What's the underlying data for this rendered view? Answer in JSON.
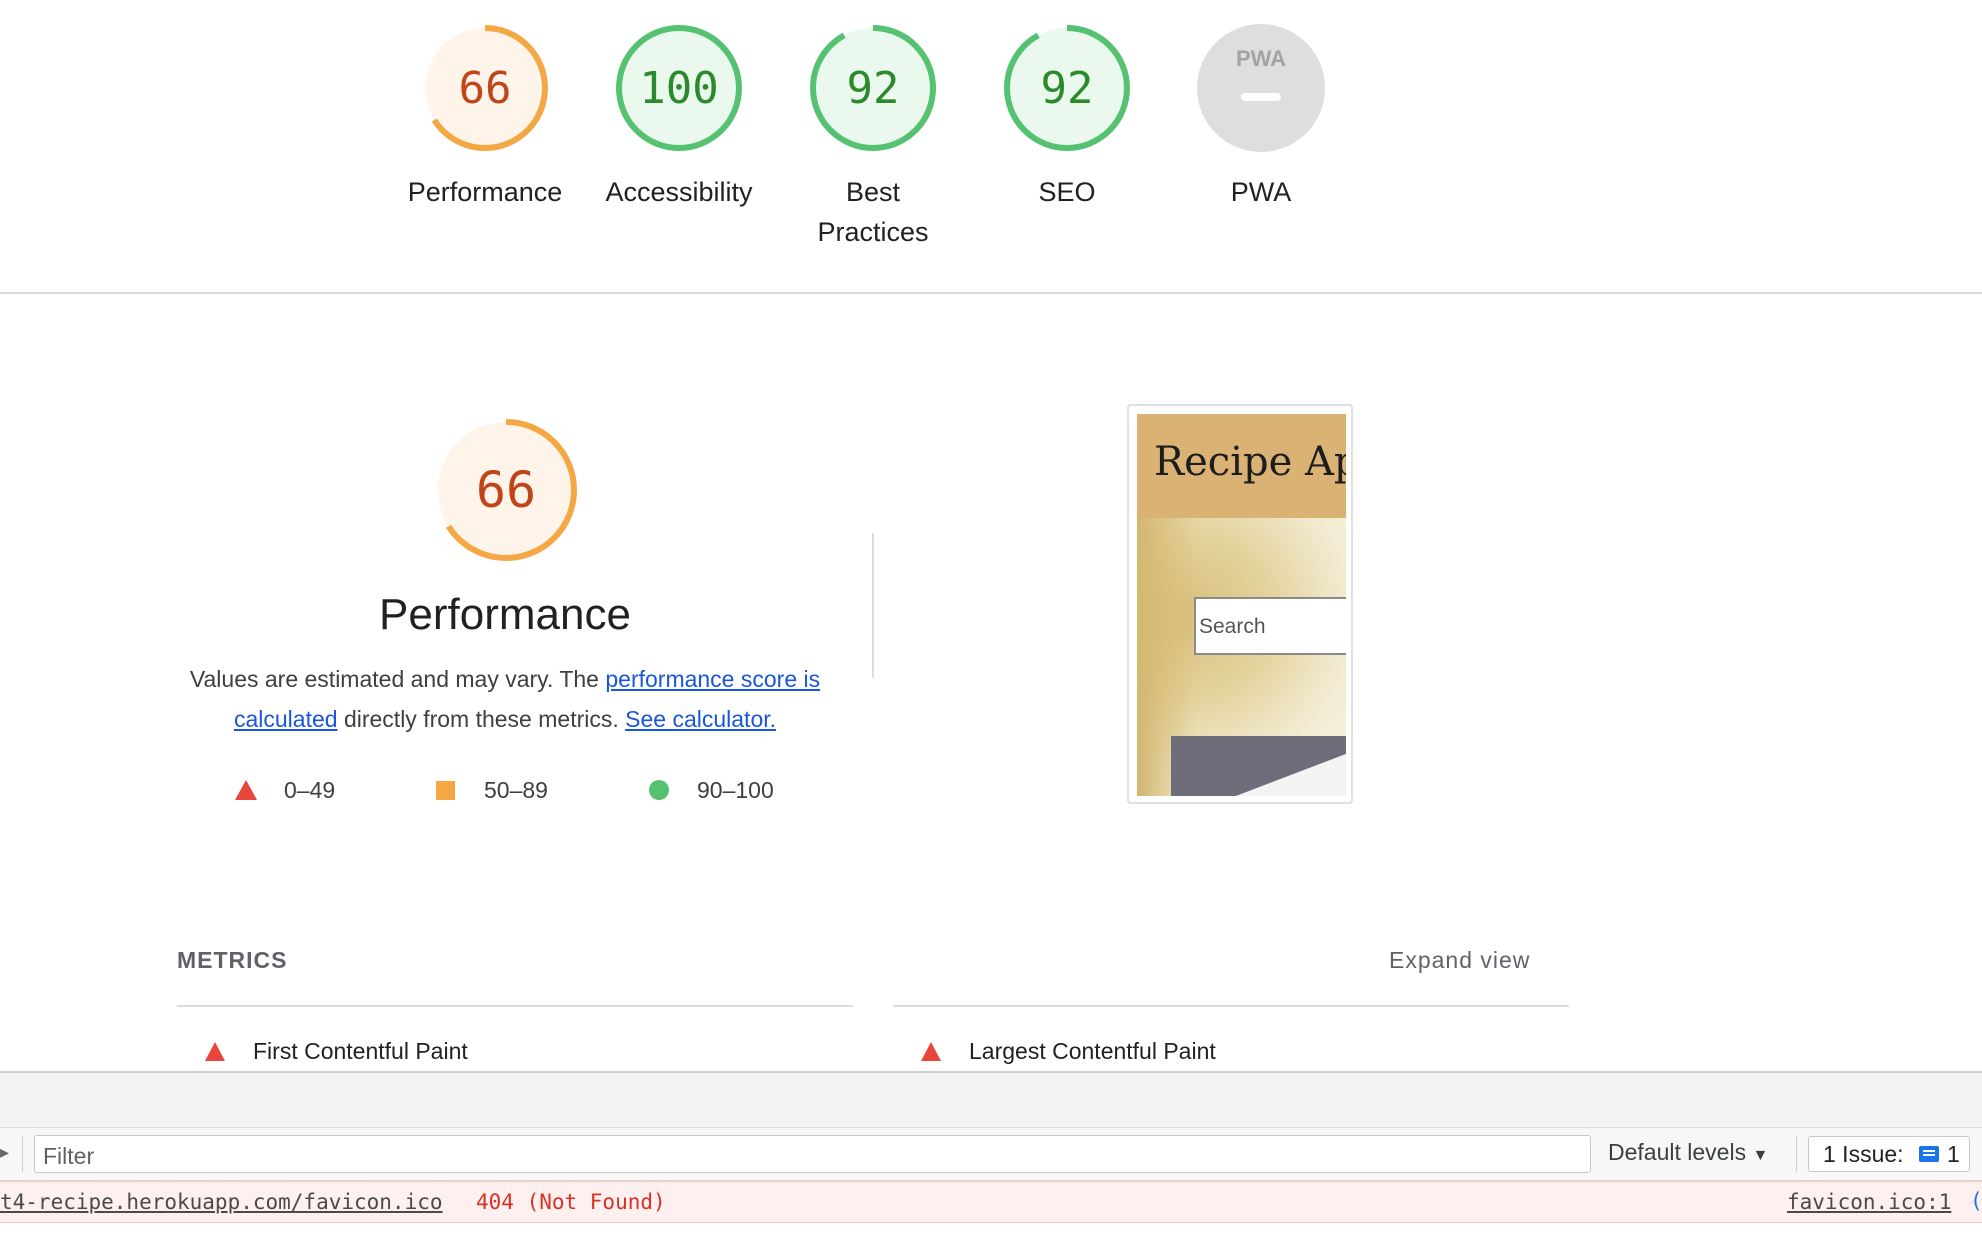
{
  "scores": [
    {
      "value": "66",
      "label": "Performance",
      "score": 0.66,
      "color": "#f4a742",
      "text_color": "#c0451b",
      "bg": "#fef4ea"
    },
    {
      "value": "100",
      "label": "Accessibility",
      "score": 1.0,
      "color": "#55c271",
      "text_color": "#2b8a2b",
      "bg": "#eaf8ee"
    },
    {
      "value": "92",
      "label": "Best Practices",
      "score": 0.92,
      "color": "#55c271",
      "text_color": "#2b8a2b",
      "bg": "#eaf8ee"
    },
    {
      "value": "92",
      "label": "SEO",
      "score": 0.92,
      "color": "#55c271",
      "text_color": "#2b8a2b",
      "bg": "#eaf8ee"
    },
    {
      "value": "PWA",
      "label": "PWA",
      "score": null,
      "color": "#d9d9d9",
      "text_color": "#9a9a9a",
      "bg": "#dedede"
    }
  ],
  "performance": {
    "score": "66",
    "title": "Performance",
    "desc_prefix": "Values are estimated and may vary. The ",
    "desc_link1": "performance score is calculated",
    "desc_middle": " directly from these metrics. ",
    "desc_link2": "See calculator."
  },
  "legend": [
    {
      "range": "0–49",
      "icon": "triangle-icon",
      "color": "#e8453c"
    },
    {
      "range": "50–89",
      "icon": "square-icon",
      "color": "#f4a742"
    },
    {
      "range": "90–100",
      "icon": "circle-icon",
      "color": "#55c271"
    }
  ],
  "thumbnail": {
    "title": "Recipe App",
    "search_placeholder": "Search"
  },
  "metrics": {
    "header": "METRICS",
    "expand": "Expand view",
    "items": [
      "First Contentful Paint",
      "Largest Contentful Paint"
    ]
  },
  "console": {
    "filter_placeholder": "Filter",
    "levels": "Default levels",
    "issues_label": "1 Issue:",
    "issues_count": "1",
    "error_url": "t4-recipe.herokuapp.com/favicon.ico",
    "error_status": "404 (Not Found)",
    "error_source": "favicon.ico:1"
  }
}
